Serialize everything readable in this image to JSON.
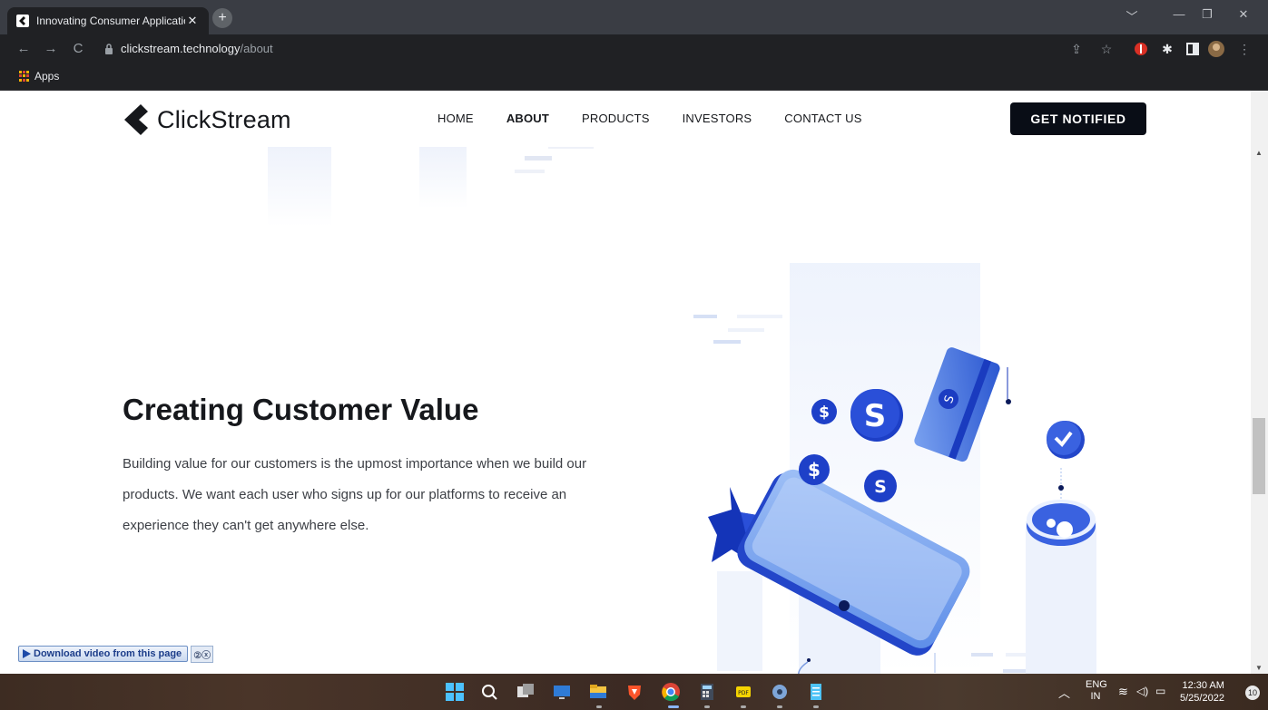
{
  "browser": {
    "tab_title": "Innovating Consumer Applicatio",
    "tab_close": "✕",
    "new_tab": "+",
    "url_host": "clickstream.technology",
    "url_path": "/about",
    "bookmarks_apps": "Apps",
    "window_controls": [
      "﹀",
      "—",
      "❐",
      "✕"
    ]
  },
  "site": {
    "logo_text": "ClickStream",
    "nav": [
      {
        "label": "HOME",
        "active": false
      },
      {
        "label": "ABOUT",
        "active": true
      },
      {
        "label": "PRODUCTS",
        "active": false
      },
      {
        "label": "INVESTORS",
        "active": false
      },
      {
        "label": "CONTACT US",
        "active": false
      }
    ],
    "cta_label": "GET NOTIFIED"
  },
  "section": {
    "headline": "Creating Customer Value",
    "body": "Building value for our customers is the upmost importance when we build our products. We want each user who signs up for our platforms to receive an experience they can't get anywhere else."
  },
  "download_widget": {
    "label": "Download video from this page",
    "extras": "②ⓧ"
  },
  "taskbar": {
    "lang_top": "ENG",
    "lang_bottom": "IN",
    "time": "12:30 AM",
    "date": "5/25/2022",
    "notifications": "10"
  },
  "colors": {
    "accent_blue": "#1f43c4",
    "cta_bg": "#090d16"
  }
}
